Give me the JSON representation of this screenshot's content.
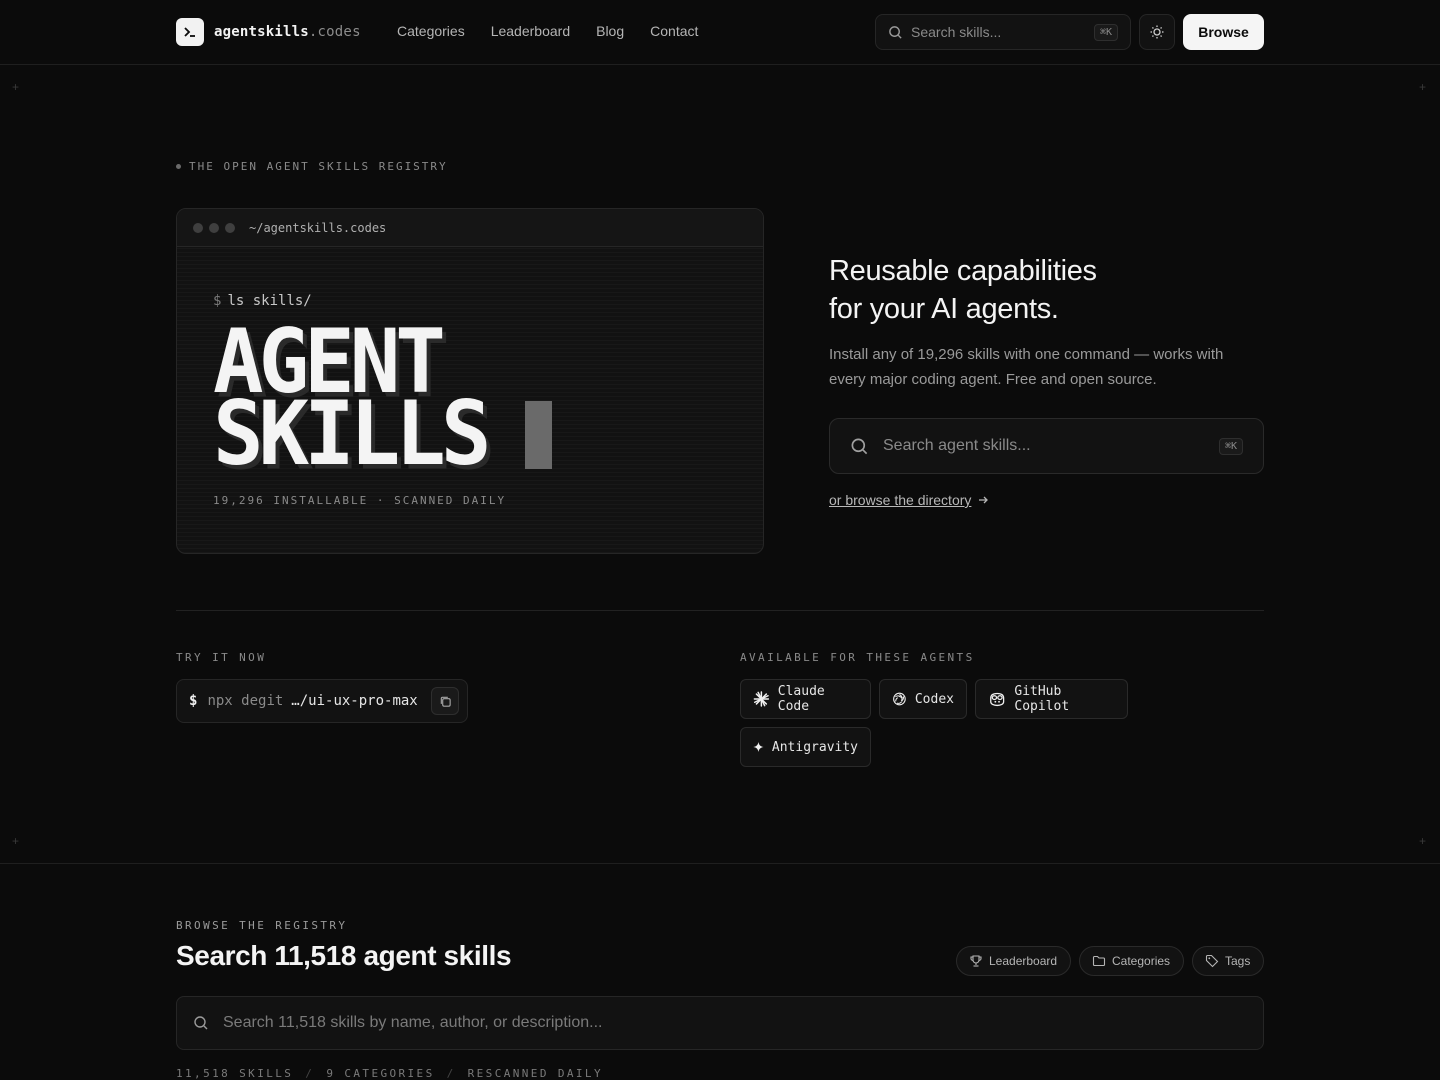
{
  "header": {
    "logo_main": "agentskills",
    "logo_suffix": ".codes",
    "nav": [
      "Categories",
      "Leaderboard",
      "Blog",
      "Contact"
    ],
    "search_placeholder": "Search skills...",
    "search_shortcut": "⌘K",
    "browse_label": "Browse"
  },
  "hero": {
    "eyebrow": "THE OPEN AGENT SKILLS REGISTRY",
    "terminal_path": "~/agentskills.codes",
    "prompt_symbol": "$",
    "prompt_command": "ls skills/",
    "big_line1": "AGENT",
    "big_line2": "SKILLS",
    "terminal_meta": "19,296 INSTALLABLE · SCANNED DAILY",
    "headline_line1": "Reusable capabilities",
    "headline_line2": "for your AI agents.",
    "subtext": "Install any of 19,296 skills with one command — works with every major coding agent. Free and open source.",
    "search_placeholder": "Search agent skills...",
    "search_shortcut": "⌘K",
    "browse_link": "or browse the directory"
  },
  "try_now": {
    "label": "TRY IT NOW",
    "dollar": "$",
    "cmd": "npx degit",
    "arg": "…/ui-ux-pro-max"
  },
  "agents": {
    "label": "AVAILABLE FOR THESE AGENTS",
    "items": [
      "Claude Code",
      "Codex",
      "GitHub Copilot",
      "Antigravity"
    ]
  },
  "registry": {
    "eyebrow": "BROWSE THE REGISTRY",
    "title": "Search 11,518 agent skills",
    "pills": [
      "Leaderboard",
      "Categories",
      "Tags"
    ],
    "search_placeholder": "Search 11,518 skills by name, author, or description...",
    "meta": [
      "11,518 SKILLS",
      "9 CATEGORIES",
      "RESCANNED DAILY"
    ],
    "meta_sep": "/"
  }
}
